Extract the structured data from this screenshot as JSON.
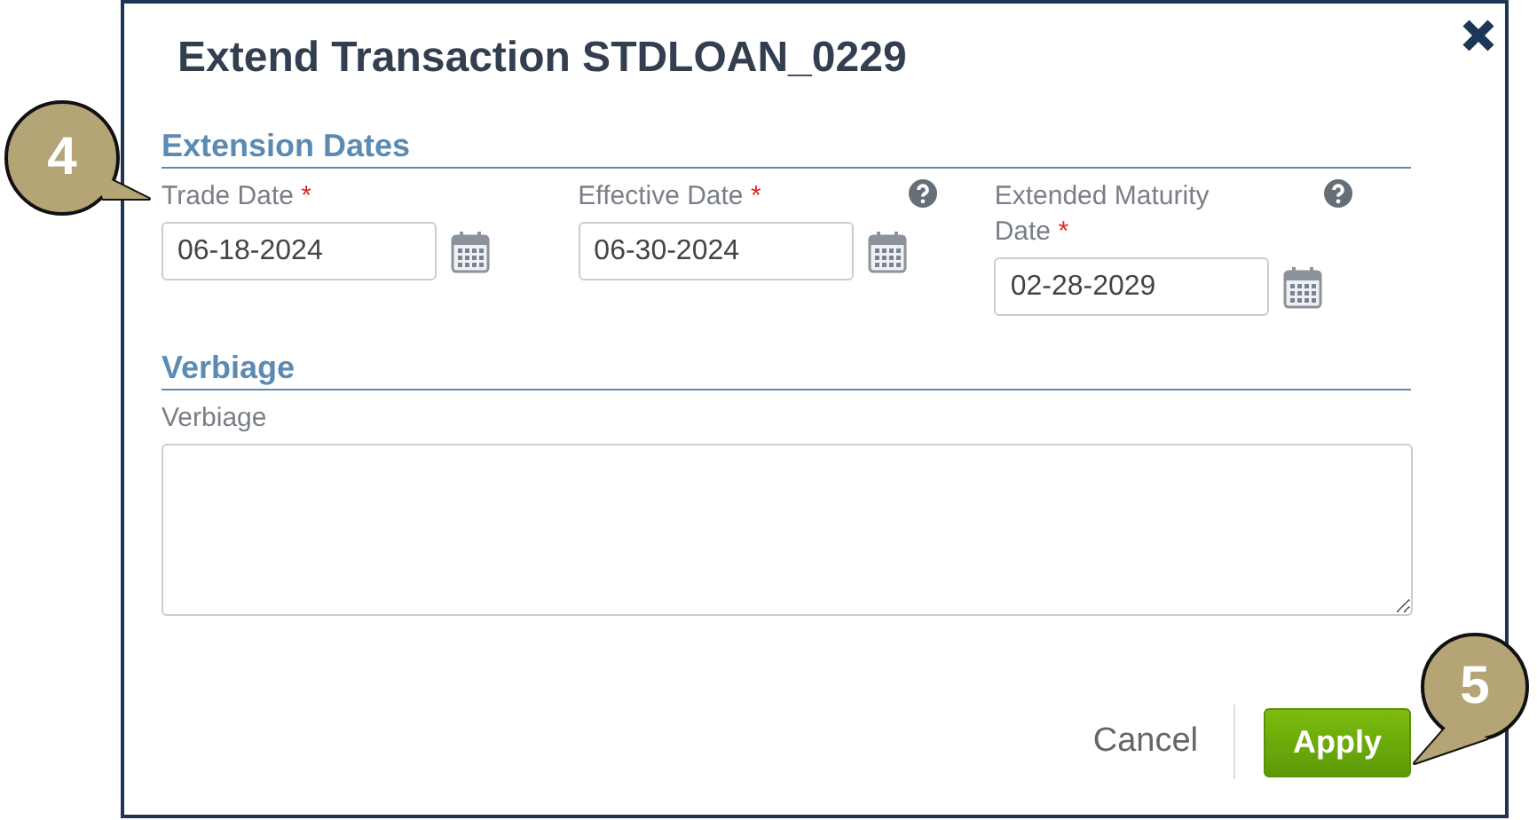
{
  "dialog": {
    "title": "Extend Transaction STDLOAN_0229",
    "dates_section": {
      "heading": "Extension Dates",
      "fields": [
        {
          "label": "Trade Date",
          "required": true,
          "required_mark": "*",
          "help": false,
          "value": "06-18-2024"
        },
        {
          "label": "Effective Date",
          "required": true,
          "required_mark": "*",
          "help": true,
          "value": "06-30-2024"
        },
        {
          "label": "Extended Maturity Date",
          "required": true,
          "required_mark": "*",
          "help": true,
          "value": "02-28-2029"
        }
      ]
    },
    "verbiage_section": {
      "heading": "Verbiage",
      "label": "Verbiage"
    },
    "footer": {
      "cancel": "Cancel",
      "apply": "Apply"
    }
  },
  "callouts": [
    {
      "number": "4"
    },
    {
      "number": "5"
    }
  ]
}
